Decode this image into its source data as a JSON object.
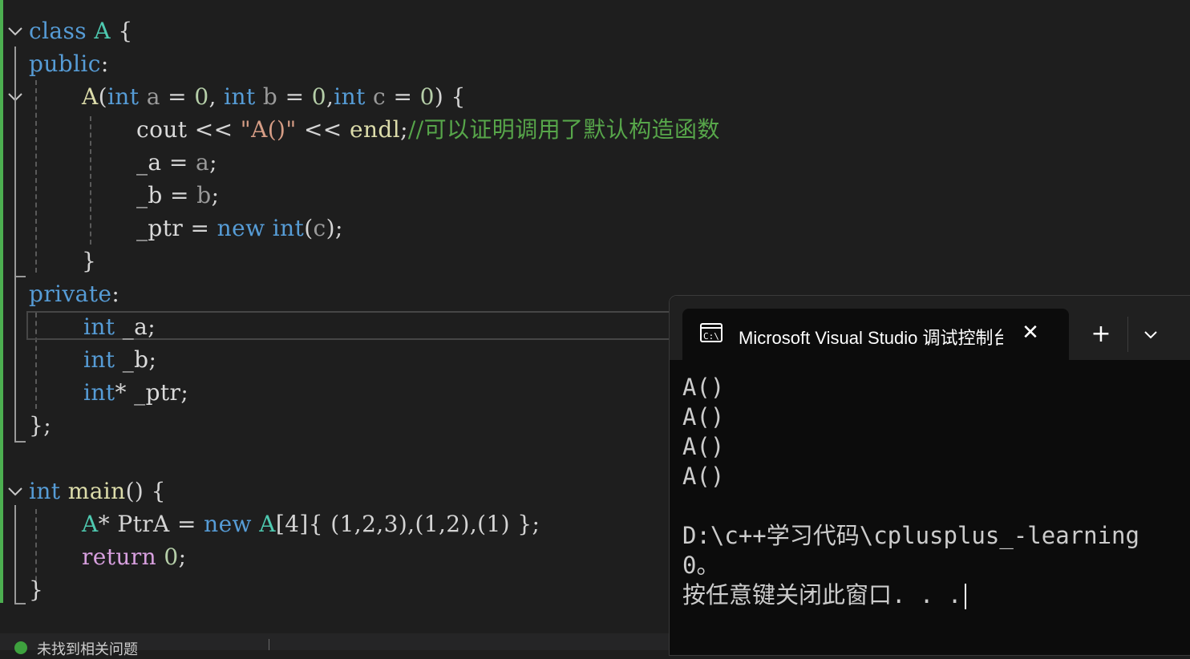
{
  "editor": {
    "line1": {
      "kw": "class",
      "name": "A",
      "brace": "{"
    },
    "line2": {
      "kw": "public",
      "colon": ":"
    },
    "line3": {
      "ctor": "A",
      "p1": "(",
      "t1": "int",
      "a1": "a",
      "eq1": "=",
      "v1": "0",
      "c1": ",",
      "t2": "int",
      "a2": "b",
      "eq2": "=",
      "v2": "0",
      "c2": ",",
      "t3": "int",
      "a3": "c",
      "eq3": "=",
      "v3": "0",
      "p2": ")",
      "brace": "{"
    },
    "line4": {
      "ident": "cout",
      "op": "<<",
      "str": "\"A()\"",
      "op2": "<<",
      "endl": "endl",
      "semi": ";",
      "comment": "//可以证明调用了默认构造函数"
    },
    "line5": {
      "member": "_a",
      "eq": "=",
      "arg": "a",
      "semi": ";"
    },
    "line6": {
      "member": "_b",
      "eq": "=",
      "arg": "b",
      "semi": ";"
    },
    "line7": {
      "member": "_ptr",
      "eq": "=",
      "kw": "new",
      "ty": "int",
      "p1": "(",
      "arg": "c",
      "p2": ")",
      "semi": ";"
    },
    "line8": {
      "brace": "}"
    },
    "line9": {
      "kw": "private",
      "colon": ":"
    },
    "line10": {
      "ty": "int",
      "member": "_a",
      "semi": ";"
    },
    "line11": {
      "ty": "int",
      "member": "_b",
      "semi": ";"
    },
    "line12": {
      "ty": "int",
      "star": "*",
      "member": "_ptr",
      "semi": ";"
    },
    "line13": {
      "text": "};"
    },
    "line14": {
      "ty": "int",
      "fn": "main",
      "parens": "()",
      "brace": "{"
    },
    "line15": {
      "cls": "A",
      "star": "*",
      "var": "PtrA",
      "eq": "=",
      "kw": "new",
      "cls2": "A",
      "rest": "[4]{ (1,2,3),(1,2),(1) };"
    },
    "line16": {
      "kw": "return",
      "num": "0",
      "semi": ";"
    },
    "line17": {
      "brace": "}"
    }
  },
  "statusbar": {
    "issues_text": "未找到相关问题"
  },
  "terminal": {
    "tab_title": "Microsoft Visual Studio 调试控制台",
    "close_glyph": "✕",
    "new_tab_glyph": "+",
    "output_lines": [
      "A()",
      "A()",
      "A()",
      "A()",
      "",
      "D:\\c++学习代码\\cplusplus_-learning",
      "0。",
      "按任意键关闭此窗口. . ."
    ]
  },
  "colors": {
    "keyword": "#569cd6",
    "type": "#4ec9b0",
    "function": "#dcdcaa",
    "string": "#d69d85",
    "comment": "#57a64a",
    "number": "#b5cea8",
    "control": "#d8a0df",
    "param": "#9a9a9a"
  }
}
